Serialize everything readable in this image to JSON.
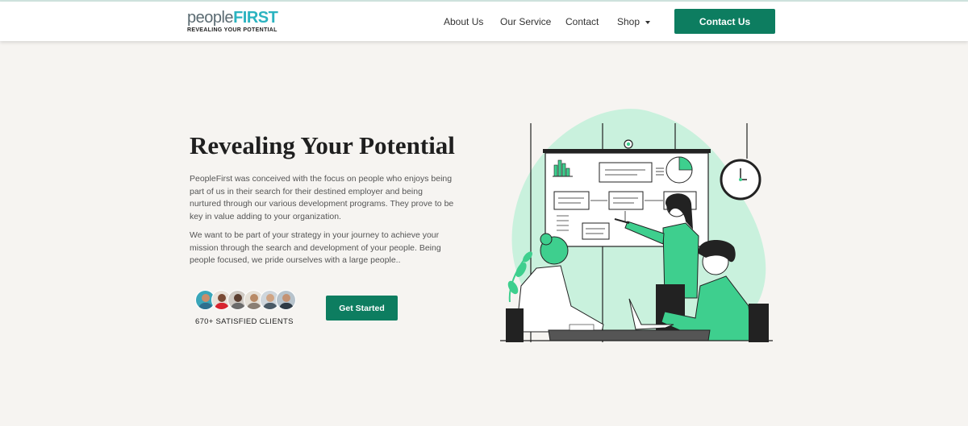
{
  "brand": {
    "logo_people": "people",
    "logo_first": "FIRST",
    "tagline": "REVEALING YOUR POTENTIAL"
  },
  "nav": {
    "items": [
      {
        "label": "About Us"
      },
      {
        "label": "Our Service"
      },
      {
        "label": "Contact"
      },
      {
        "label": "Shop"
      }
    ],
    "cta_label": "Contact Us"
  },
  "hero": {
    "title": "Revealing Your Potential",
    "paragraph_1": "PeopleFirst was conceived with the focus on people who enjoys being part of us in their search for their destined employer and being nurtured through our various development programs. They prove to be key in value adding to your organization.",
    "paragraph_2": "We want to be part of your strategy in your journey to achieve your mission through the search and development of your people. Being people focused, we pride ourselves with a large people..",
    "clients_label": "670+ SATISFIED CLIENTS",
    "cta_label": "Get Started"
  },
  "icons": {
    "dropdown": "chevron-down-icon",
    "client_avatars": "avatar"
  },
  "colors": {
    "accent": "#0d7d60",
    "logo_accent": "#2bb3c0",
    "page_bg": "#f6f4f1",
    "illustration_mint": "#c9f1dd",
    "illustration_green": "#3ecf8e"
  }
}
